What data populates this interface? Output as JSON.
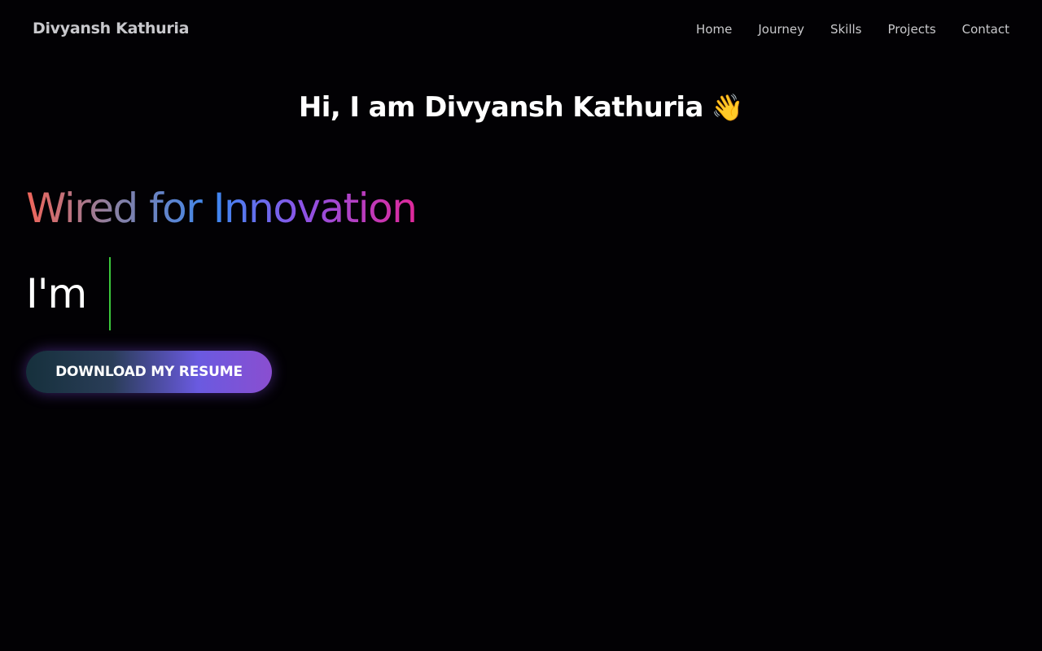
{
  "header": {
    "brand": "Divyansh Kathuria",
    "nav": [
      "Home",
      "Journey",
      "Skills",
      "Projects",
      "Contact"
    ]
  },
  "hero": {
    "greeting": "Hi, I am Divyansh Kathuria",
    "greeting_emoji": "👋",
    "tagline": "Wired for Innovation",
    "typing_prefix": "I'm",
    "typing_text": "",
    "resume_button": "DOWNLOAD MY RESUME"
  },
  "colors": {
    "background": "#020104",
    "cursor": "#3cc83c",
    "gradient_start": "#f0655a",
    "gradient_mid": "#3d88f0",
    "gradient_end": "#e0289a"
  },
  "icons": {
    "greeting_emoji": "waving-hand-icon"
  }
}
